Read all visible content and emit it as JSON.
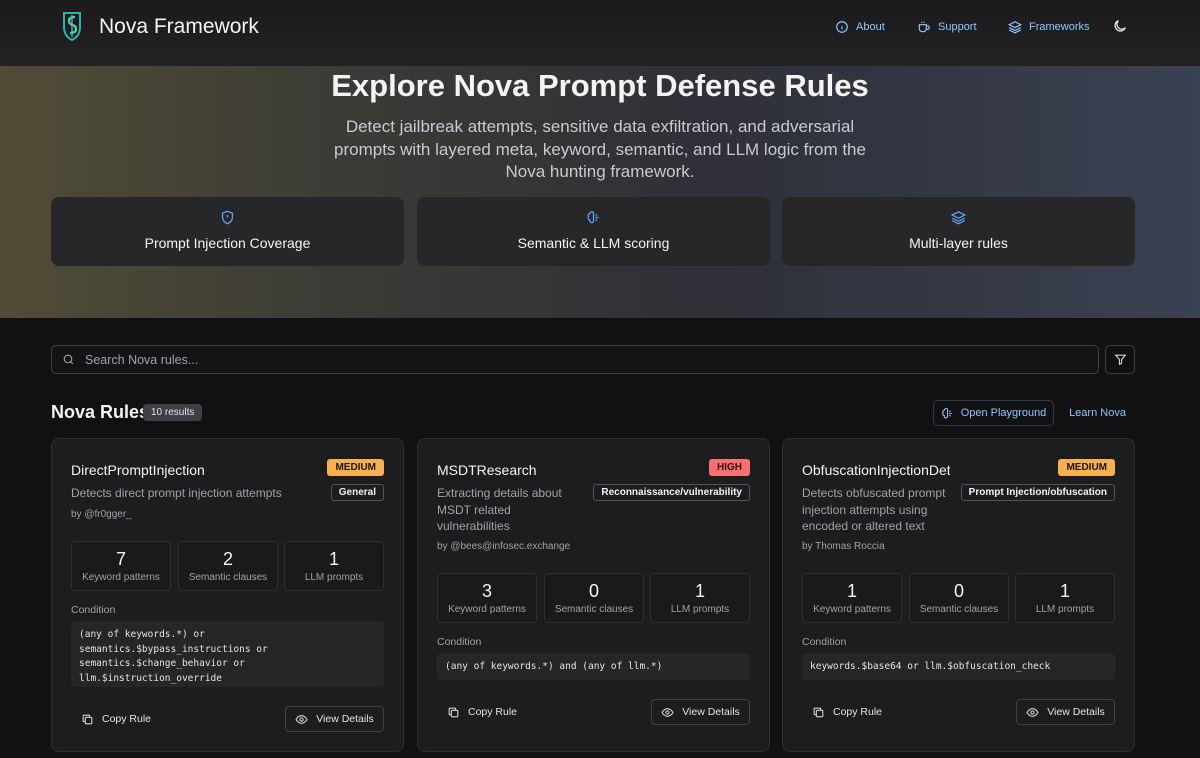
{
  "header": {
    "brand": "Nova Framework",
    "nav": [
      {
        "label": "About",
        "icon": "info-icon"
      },
      {
        "label": "Support",
        "icon": "coffee-icon"
      },
      {
        "label": "Frameworks",
        "icon": "layers-icon"
      }
    ],
    "theme_icon": "moon-icon"
  },
  "hero": {
    "title": "Explore Nova Prompt Defense Rules",
    "subtitle": "Detect jailbreak attempts, sensitive data exfiltration, and adversarial prompts with layered meta, keyword, semantic, and LLM logic from the Nova hunting framework.",
    "features": [
      {
        "label": "Prompt Injection Coverage",
        "icon": "shield-icon"
      },
      {
        "label": "Semantic & LLM scoring",
        "icon": "brain-icon"
      },
      {
        "label": "Multi-layer rules",
        "icon": "layers-icon"
      }
    ]
  },
  "search": {
    "placeholder": "Search Nova rules..."
  },
  "rules_section": {
    "title": "Nova Rules",
    "results": "10 results",
    "playground_label": "Open Playground",
    "learn_label": "Learn Nova"
  },
  "colors": {
    "accent": "#60a5fa",
    "medium": "#f6b050",
    "high": "#f87171",
    "background": "#111113",
    "card": "#1d1d20"
  },
  "cards": [
    {
      "name": "DirectPromptInjection",
      "severity": "MEDIUM",
      "category": "General",
      "description": "Detects direct prompt injection attempts",
      "author": "by @fr0gger_",
      "stats": [
        {
          "value": "7",
          "label": "Keyword patterns"
        },
        {
          "value": "2",
          "label": "Semantic clauses"
        },
        {
          "value": "1",
          "label": "LLM prompts"
        }
      ],
      "condition_label": "Condition",
      "condition": "(any of keywords.*) or\nsemantics.$bypass_instructions or\nsemantics.$change_behavior or\nllm.$instruction_override",
      "copy_label": "Copy Rule",
      "view_label": "View Details"
    },
    {
      "name": "MSDTResearch",
      "severity": "HIGH",
      "category": "Reconnaissance/vulnerability",
      "description": "Extracting details about MSDT related vulnerabilities",
      "author": "by @bees@infosec.exchange",
      "stats": [
        {
          "value": "3",
          "label": "Keyword patterns"
        },
        {
          "value": "0",
          "label": "Semantic clauses"
        },
        {
          "value": "1",
          "label": "LLM prompts"
        }
      ],
      "condition_label": "Condition",
      "condition": "(any of keywords.*) and (any of llm.*)",
      "copy_label": "Copy Rule",
      "view_label": "View Details"
    },
    {
      "name": "ObfuscationInjectionDetection",
      "severity": "MEDIUM",
      "category": "Prompt Injection/obfuscation",
      "description": "Detects obfuscated prompt injection attempts using encoded or altered text",
      "author": "by Thomas Roccia",
      "stats": [
        {
          "value": "1",
          "label": "Keyword patterns"
        },
        {
          "value": "0",
          "label": "Semantic clauses"
        },
        {
          "value": "1",
          "label": "LLM prompts"
        }
      ],
      "condition_label": "Condition",
      "condition": "keywords.$base64 or llm.$obfuscation_check",
      "copy_label": "Copy Rule",
      "view_label": "View Details"
    }
  ]
}
